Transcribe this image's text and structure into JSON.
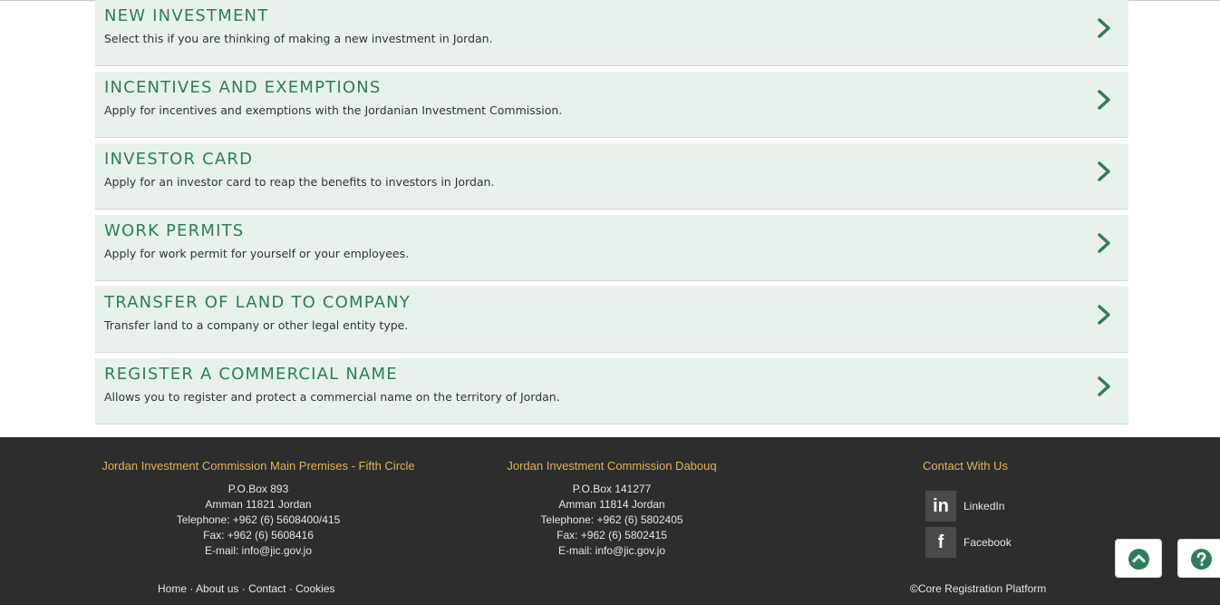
{
  "services": [
    {
      "title": "NEW INVESTMENT",
      "desc": "Select this if you are thinking of making a new investment in Jordan."
    },
    {
      "title": "INCENTIVES AND EXEMPTIONS",
      "desc": "Apply for incentives and exemptions with the Jordanian Investment Commission."
    },
    {
      "title": "INVESTOR CARD",
      "desc": "Apply for an investor card to reap the benefits to investors in Jordan."
    },
    {
      "title": "WORK PERMITS",
      "desc": "Apply for work permit for yourself or your employees."
    },
    {
      "title": "TRANSFER OF LAND TO COMPANY",
      "desc": "Transfer land to a company or other legal entity type."
    },
    {
      "title": "REGISTER A COMMERCIAL NAME",
      "desc": "Allows you to register and protect a commercial name on the territory of Jordan."
    }
  ],
  "footer": {
    "main": {
      "heading": "Jordan Investment Commission Main Premises - Fifth Circle",
      "lines": [
        "P.O.Box 893",
        "Amman 11821 Jordan",
        "Telephone: +962 (6) 5608400/415",
        "Fax: +962 (6) 5608416",
        "E-mail: info@jic.gov.jo"
      ]
    },
    "dabouq": {
      "heading": "Jordan Investment Commission Dabouq",
      "lines": [
        "P.O.Box 141277",
        "Amman 11814 Jordan",
        "Telephone: +962 (6) 5802405",
        "Fax: +962 (6) 5802415",
        "E-mail: info@jic.gov.jo"
      ]
    },
    "contact": {
      "heading": "Contact With Us",
      "linkedin_icon": "in",
      "linkedin": "LinkedIn",
      "facebook_icon": "f",
      "facebook": "Facebook"
    },
    "links": {
      "home": "Home",
      "about": "About us",
      "contact": "Contact",
      "cookies": "Cookies",
      "sep": " · "
    },
    "copyright": "©Core Registration Platform"
  },
  "colors": {
    "accent": "#2e7d5b",
    "heading": "#e0b25c",
    "card_bg": "#e8f2ec",
    "footer_bg": "#2d2d2d"
  },
  "icons": {
    "chevron": "chevron-right-icon",
    "up": "arrow-up-circle-icon",
    "help": "question-circle-icon"
  }
}
